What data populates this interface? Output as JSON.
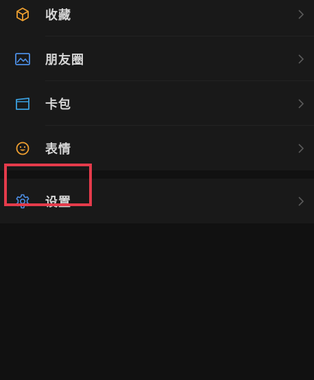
{
  "menu": {
    "group1": [
      {
        "label": "收藏",
        "icon": "cube-icon",
        "color": "#f0a030"
      },
      {
        "label": "朋友圈",
        "icon": "image-icon",
        "color": "#4d8fe6"
      },
      {
        "label": "卡包",
        "icon": "card-wallet-icon",
        "color": "#3ba0e0"
      },
      {
        "label": "表情",
        "icon": "smiley-icon",
        "color": "#f0a030"
      }
    ],
    "group2": [
      {
        "label": "设置",
        "icon": "gear-icon",
        "color": "#4d8fe6"
      }
    ]
  },
  "highlight": {
    "target": "设置",
    "color": "#e53b4b"
  },
  "colors": {
    "background": "#111111",
    "row": "#191919",
    "text": "#d6d6d6",
    "chevron": "#5a5a5a"
  }
}
